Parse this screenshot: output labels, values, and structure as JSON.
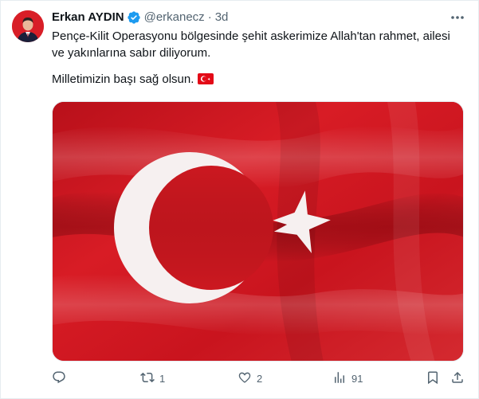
{
  "tweet": {
    "author": {
      "display_name": "Erkan AYDIN",
      "handle": "@erkanecz",
      "verified": true
    },
    "separator": "·",
    "time": "3d",
    "text_lines": [
      "Pençe-Kilit Operasyonu bölgesinde şehit askerimize Allah'tan rahmet, ailesi",
      "ve yakınlarına sabır diliyorum."
    ],
    "text_line_2": "Milletimizin başı sağ olsun.",
    "emoji": "turkey-flag-emoji",
    "media": {
      "image": "turkish-flag-waving"
    }
  },
  "actions": {
    "reply": {
      "icon": "reply-icon",
      "count": ""
    },
    "retweet": {
      "icon": "retweet-icon",
      "count": "1"
    },
    "like": {
      "icon": "heart-icon",
      "count": "2"
    },
    "views": {
      "icon": "views-icon",
      "count": "91"
    },
    "bookmark": {
      "icon": "bookmark-icon"
    },
    "share": {
      "icon": "share-icon"
    }
  },
  "colors": {
    "text": "#0f1419",
    "secondary": "#536471",
    "verified": "#1d9bf0",
    "flag_red": "#e30a17"
  }
}
